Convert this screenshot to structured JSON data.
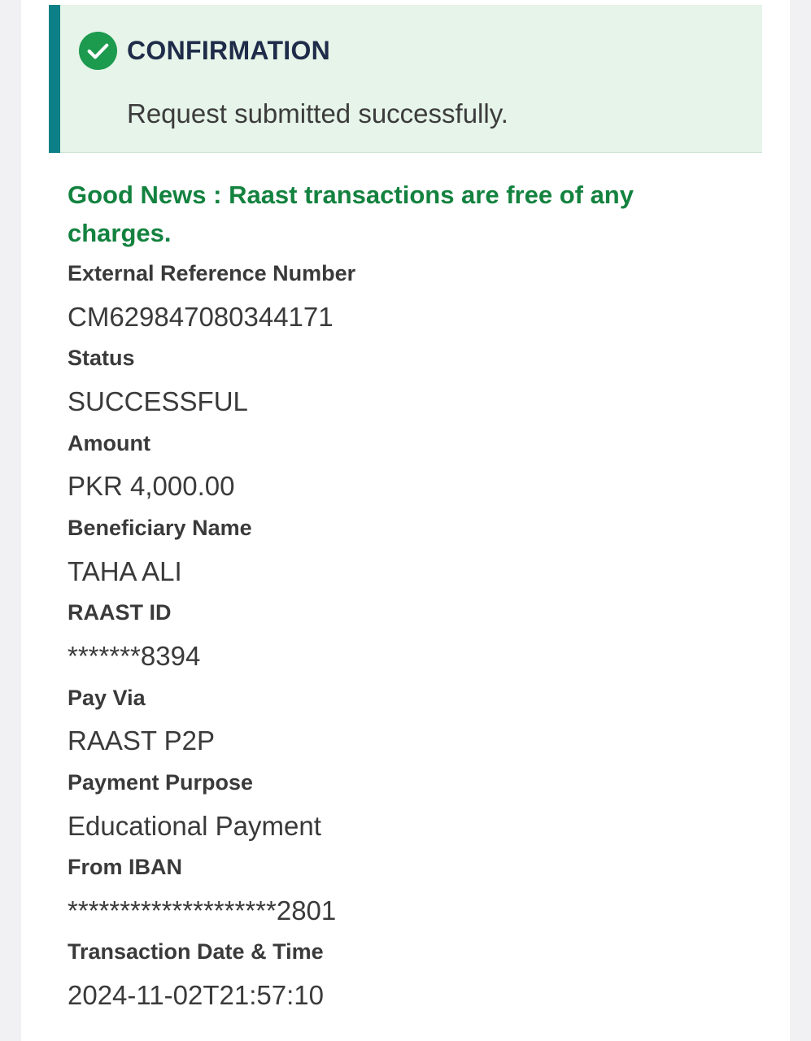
{
  "confirmation": {
    "title": "CONFIRMATION",
    "message": "Request submitted successfully.",
    "icon": "check-circle-icon",
    "icon_color": "#1c9a4e",
    "accent_bar_color": "#0d7f86",
    "background_color": "#e6f4e9"
  },
  "notice": {
    "text": "Good News : Raast transactions are free of any charges.",
    "color": "#13823f"
  },
  "details": [
    {
      "label": "External Reference Number",
      "value": "CM629847080344171"
    },
    {
      "label": "Status",
      "value": "SUCCESSFUL"
    },
    {
      "label": "Amount",
      "value": "PKR 4,000.00"
    },
    {
      "label": "Beneficiary Name",
      "value": "TAHA ALI"
    },
    {
      "label": "RAAST ID",
      "value": "*******8394"
    },
    {
      "label": "Pay Via",
      "value": "RAAST P2P"
    },
    {
      "label": "Payment Purpose",
      "value": "Educational Payment"
    },
    {
      "label": "From IBAN",
      "value": "********************2801"
    },
    {
      "label": "Transaction Date & Time",
      "value": "2024-11-02T21:57:10"
    }
  ]
}
